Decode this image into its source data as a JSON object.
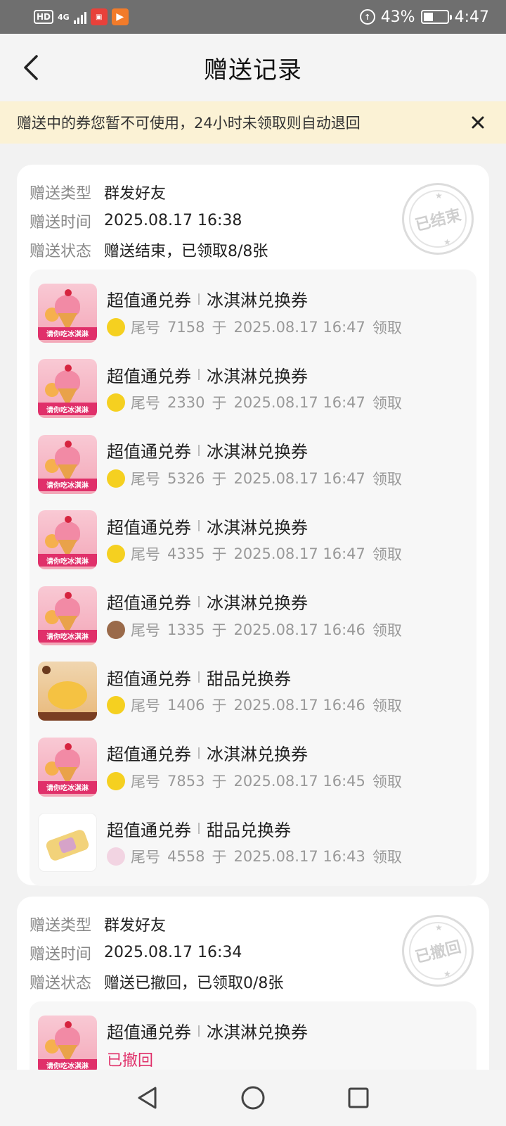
{
  "status_bar": {
    "hd": "HD",
    "network": "4G",
    "battery_percent": "43%",
    "battery_level": 0.43,
    "time": "4:47"
  },
  "header": {
    "title": "赠送记录"
  },
  "notice": {
    "text": "赠送中的券您暂不可使用，24小时未领取则自动退回"
  },
  "labels": {
    "type": "赠送类型",
    "time": "赠送时间",
    "status": "赠送状态",
    "tail": "尾号",
    "at": "于",
    "received": "领取"
  },
  "records": [
    {
      "type": "群发好友",
      "time": "2025.08.17 16:38",
      "status": "赠送结束，已领取8/8张",
      "stamp": "已结束",
      "items": [
        {
          "brand": "超值通兑券",
          "name": "冰淇淋兑换券",
          "thumb_text": "请你吃冰淇淋",
          "tail": "7158",
          "time": "2025.08.17 16:47"
        },
        {
          "brand": "超值通兑券",
          "name": "冰淇淋兑换券",
          "thumb_text": "请你吃冰淇淋",
          "tail": "2330",
          "time": "2025.08.17 16:47"
        },
        {
          "brand": "超值通兑券",
          "name": "冰淇淋兑换券",
          "thumb_text": "请你吃冰淇淋",
          "tail": "5326",
          "time": "2025.08.17 16:47"
        },
        {
          "brand": "超值通兑券",
          "name": "冰淇淋兑换券",
          "thumb_text": "请你吃冰淇淋",
          "tail": "4335",
          "time": "2025.08.17 16:47"
        },
        {
          "brand": "超值通兑券",
          "name": "冰淇淋兑换券",
          "thumb_text": "请你吃冰淇淋",
          "tail": "1335",
          "time": "2025.08.17 16:46"
        },
        {
          "brand": "超值通兑券",
          "name": "甜品兑换券",
          "tail": "1406",
          "time": "2025.08.17 16:46"
        },
        {
          "brand": "超值通兑券",
          "name": "冰淇淋兑换券",
          "thumb_text": "请你吃冰淇淋",
          "tail": "7853",
          "time": "2025.08.17 16:45"
        },
        {
          "brand": "超值通兑券",
          "name": "甜品兑换券",
          "tail": "4558",
          "time": "2025.08.17 16:43"
        }
      ]
    },
    {
      "type": "群发好友",
      "time": "2025.08.17 16:34",
      "status": "赠送已撤回，已领取0/8张",
      "stamp": "已撤回",
      "items": [
        {
          "brand": "超值通兑券",
          "name": "冰淇淋兑换券",
          "thumb_text": "请你吃冰淇淋",
          "state": "已撤回"
        }
      ]
    }
  ],
  "icons": {
    "back": "chevron-left-icon",
    "close": "close-icon",
    "nav_back": "triangle-back-icon",
    "nav_home": "circle-home-icon",
    "nav_recent": "square-recent-icon"
  }
}
